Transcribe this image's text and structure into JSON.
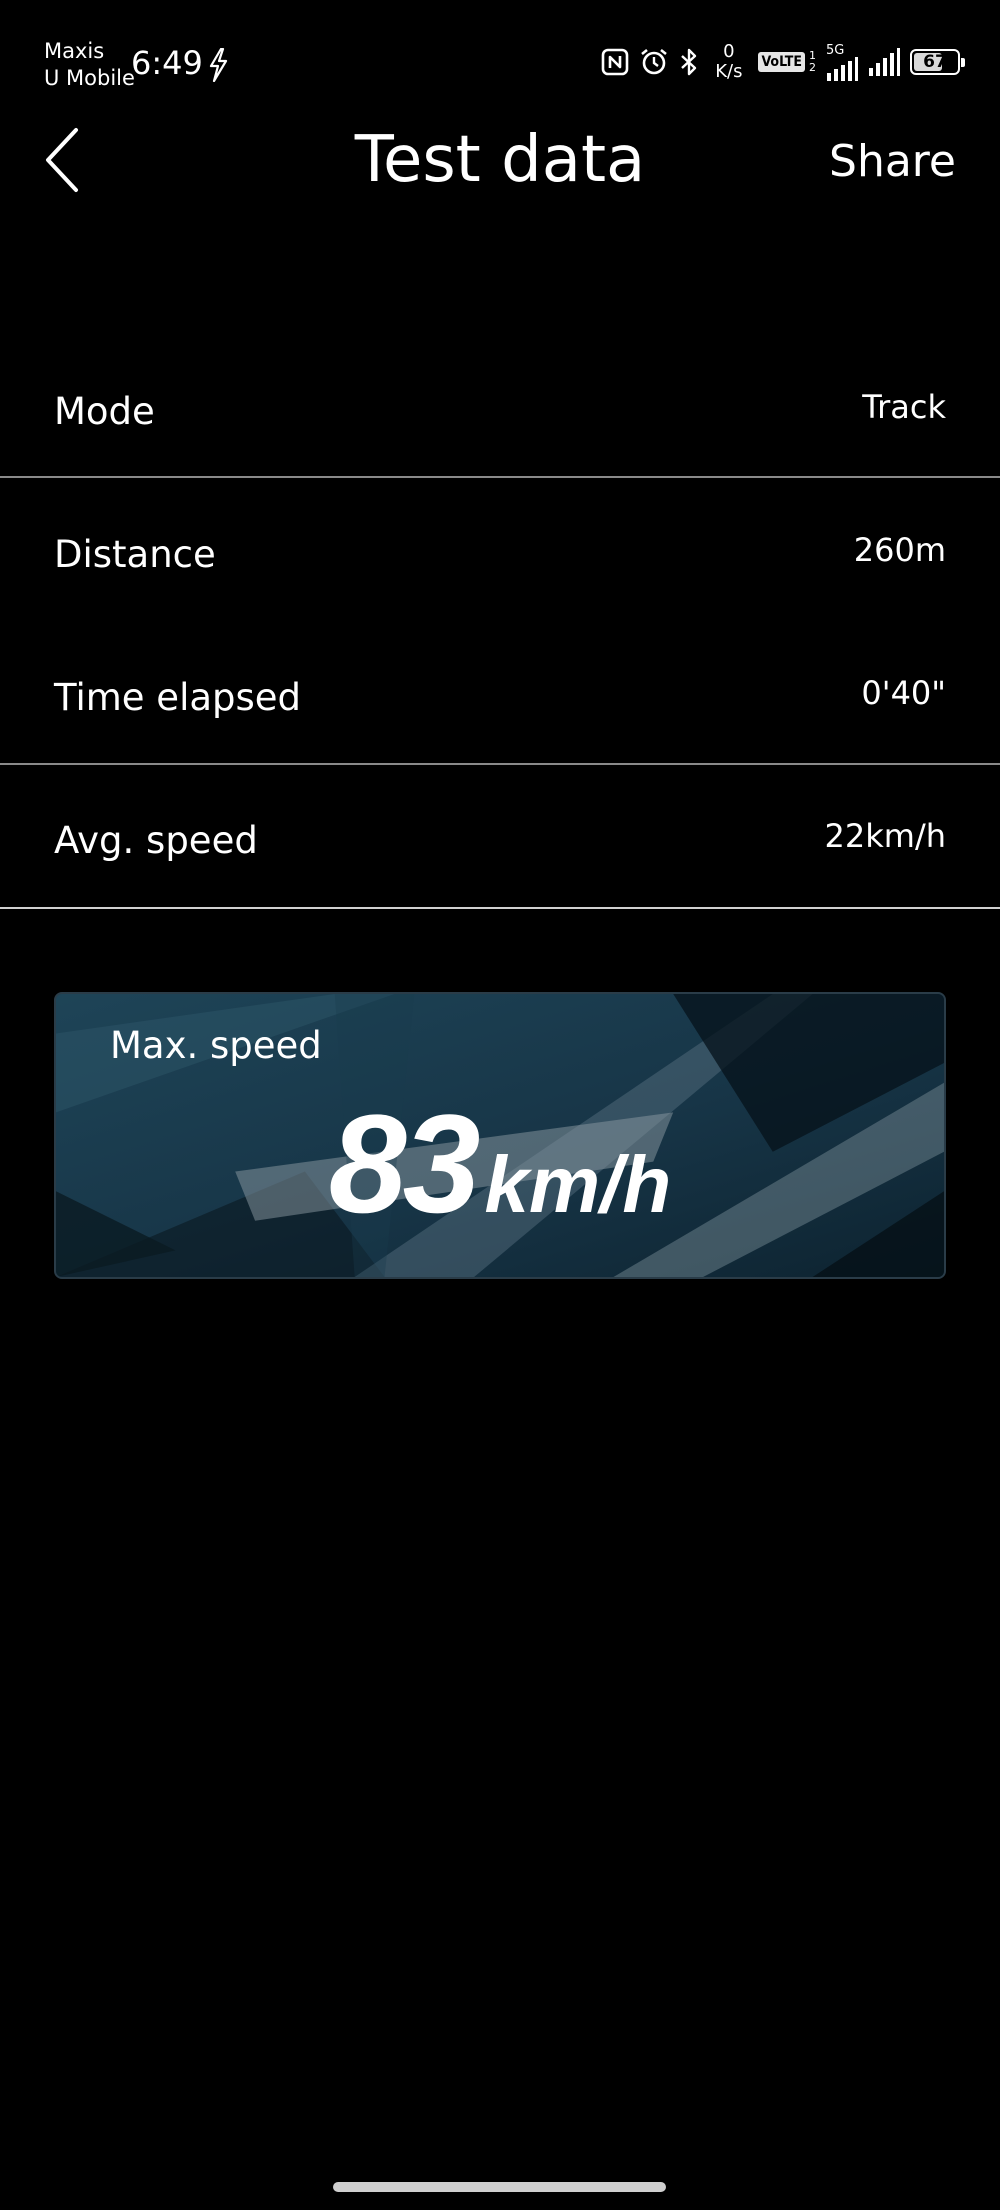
{
  "status_bar": {
    "carrier_line1": "Maxis",
    "carrier_line2": "U Mobile",
    "time": "6:49",
    "net_speed_value": "0",
    "net_speed_unit": "K/s",
    "volte_label": "VoLTE",
    "sim1_label": "1",
    "sim2_label": "2",
    "network_type": "5G",
    "battery_level": "67",
    "battery_fraction": 0.67,
    "icons": [
      "charging-bolt-icon",
      "nfc-icon",
      "alarm-icon",
      "bluetooth-icon",
      "signal-icon",
      "battery-icon"
    ]
  },
  "header": {
    "title": "Test data",
    "share_label": "Share",
    "back_icon": "chevron-left-icon"
  },
  "rows": [
    {
      "label": "Mode",
      "value": "Track"
    },
    {
      "label": "Distance",
      "value": "260m"
    },
    {
      "label": "Time elapsed",
      "value": "0'40\""
    },
    {
      "label": "Avg. speed",
      "value": "22km/h"
    }
  ],
  "max_speed": {
    "label": "Max. speed",
    "value": "83",
    "unit": "km/h"
  },
  "colors": {
    "background": "#000000",
    "divider": "#8a8a8a",
    "card_base": "#16394d",
    "text": "#ffffff"
  }
}
